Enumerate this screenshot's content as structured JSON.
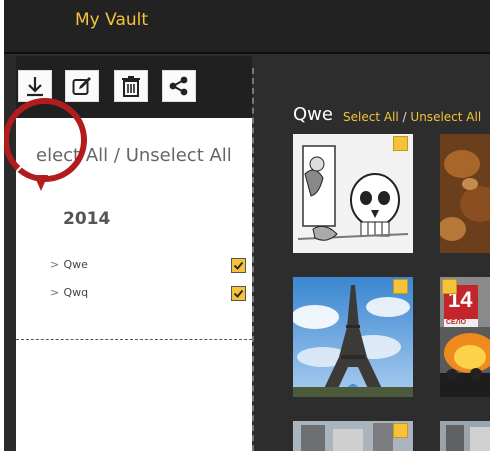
{
  "app": {
    "title": "My Vault"
  },
  "toolbar": {
    "buttons": [
      {
        "icon": "download-icon"
      },
      {
        "icon": "edit-icon"
      },
      {
        "icon": "trash-icon"
      },
      {
        "icon": "share-icon"
      }
    ]
  },
  "sidebar": {
    "select_all": "elect All",
    "separator": "/",
    "unselect_all": "Unselect All",
    "year": "2014",
    "albums": [
      {
        "chevron": ">",
        "name": "Qwe",
        "checked": true
      },
      {
        "chevron": ">",
        "name": "Qwq",
        "checked": true
      }
    ]
  },
  "main": {
    "album_name": "Qwe",
    "select_all": "Select All",
    "separator": "/",
    "unselect_all": "Unselect All",
    "photos": [
      {
        "subject": "cartoon skull at door",
        "checked": true
      },
      {
        "subject": "rusty brown texture",
        "checked": false
      },
      {
        "subject": "eiffel tower",
        "checked": true
      },
      {
        "subject": "street fire protest",
        "checked": true,
        "sign_text": "14",
        "sign_caption": "СЕЛО"
      },
      {
        "subject": "street building",
        "checked": true
      },
      {
        "subject": "street building 2",
        "checked": false
      }
    ]
  },
  "colors": {
    "accent": "#f5c23a",
    "highlight": "#b11c1c",
    "background": "#2d2d2d"
  }
}
